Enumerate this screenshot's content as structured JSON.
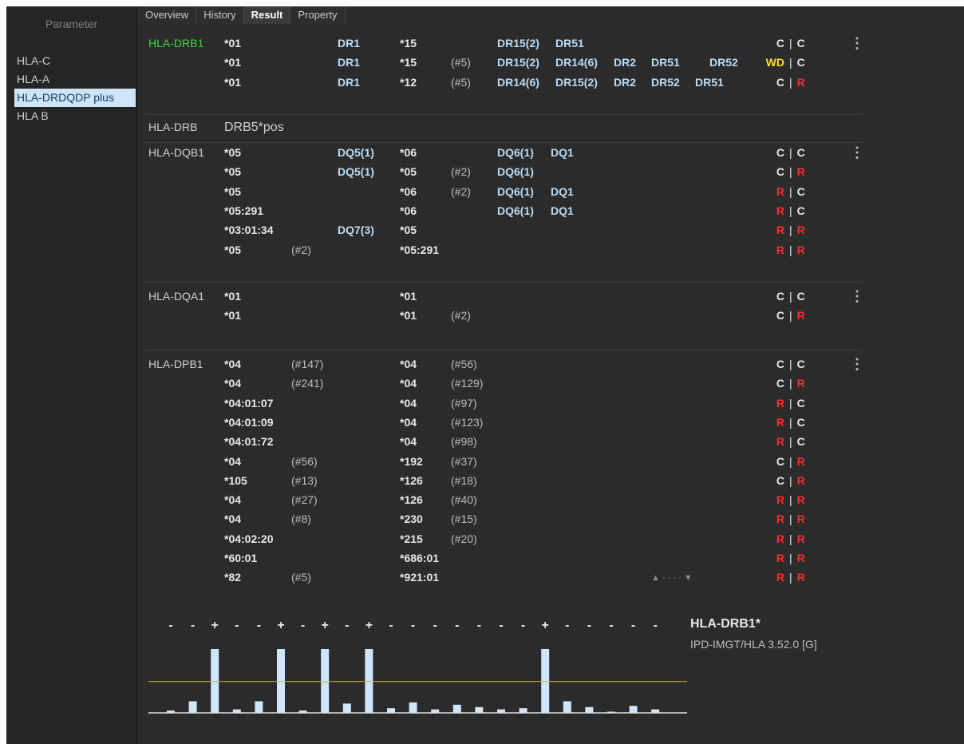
{
  "sidebar": {
    "header": "Parameter",
    "items": [
      {
        "label": "HLA-C",
        "selected": false
      },
      {
        "label": "HLA-A",
        "selected": false
      },
      {
        "label": "HLA-DRDQDP plus",
        "selected": true
      },
      {
        "label": "HLA B",
        "selected": false
      }
    ]
  },
  "tabs": [
    {
      "label": "Overview",
      "active": false
    },
    {
      "label": "History",
      "active": false
    },
    {
      "label": "Result",
      "active": true
    },
    {
      "label": "Property",
      "active": false
    }
  ],
  "colors": {
    "red": "#ff2a2a",
    "green": "#3fd33f",
    "yellow": "#ffde1a",
    "blue": "#b9dcf7"
  },
  "sections": [
    {
      "locus": "HLA-DRB1",
      "locus_color": "green",
      "menu": true,
      "rows": [
        {
          "a1": "*01",
          "n1": "",
          "s1": [
            "DR1"
          ],
          "a2": "*15",
          "n2": "",
          "s2": [
            "DR15(2)",
            "DR51"
          ],
          "f1": "C",
          "f1c": "",
          "f2": "C",
          "f2c": ""
        },
        {
          "a1": "*01",
          "n1": "",
          "s1": [
            "DR1"
          ],
          "a2": "*15",
          "n2": "(#5)",
          "s2": [
            "DR15(2)",
            "DR14(6)",
            "DR2",
            "DR51",
            "DR52"
          ],
          "f1": "WD",
          "f1c": "yellow",
          "f2": "C",
          "f2c": ""
        },
        {
          "a1": "*01",
          "n1": "",
          "s1": [
            "DR1"
          ],
          "a2": "*12",
          "n2": "(#5)",
          "s2": [
            "DR14(6)",
            "DR15(2)",
            "DR2",
            "DR52",
            "DR51"
          ],
          "f1": "C",
          "f1c": "",
          "f2": "R",
          "f2c": "red"
        }
      ]
    },
    {
      "locus": "HLA-DRB",
      "locus_color": "",
      "menu": false,
      "plain": "DRB5*pos",
      "rows": []
    },
    {
      "locus": "HLA-DQB1",
      "locus_color": "",
      "menu": true,
      "rows": [
        {
          "a1": "*05",
          "n1": "",
          "s1": [
            "DQ5(1)"
          ],
          "a2": "*06",
          "n2": "",
          "s2": [
            "DQ6(1)",
            "DQ1"
          ],
          "f1": "C",
          "f1c": "",
          "f2": "C",
          "f2c": ""
        },
        {
          "a1": "*05",
          "n1": "",
          "s1": [
            "DQ5(1)"
          ],
          "a2": "*05",
          "n2": "(#2)",
          "s2": [
            "DQ6(1)"
          ],
          "f1": "C",
          "f1c": "",
          "f2": "R",
          "f2c": "red"
        },
        {
          "a1": "*05",
          "n1": "",
          "s1": [],
          "a2": "*06",
          "n2": "(#2)",
          "s2": [
            "DQ6(1)",
            "DQ1"
          ],
          "f1": "R",
          "f1c": "red",
          "f2": "C",
          "f2c": ""
        },
        {
          "a1": "*05:291",
          "n1": "",
          "s1": [],
          "a2": "*06",
          "n2": "",
          "s2": [
            "DQ6(1)",
            "DQ1"
          ],
          "f1": "R",
          "f1c": "red",
          "f2": "C",
          "f2c": ""
        },
        {
          "a1": "*03:01:34",
          "n1": "",
          "s1": [
            "DQ7(3)"
          ],
          "a2": "*05",
          "n2": "",
          "s2": [],
          "f1": "R",
          "f1c": "red",
          "f2": "R",
          "f2c": "red"
        },
        {
          "a1": "*05",
          "n1": "(#2)",
          "s1": [],
          "a2": "*05:291",
          "n2": "",
          "s2": [],
          "f1": "R",
          "f1c": "red",
          "f2": "R",
          "f2c": "red"
        }
      ]
    },
    {
      "locus": "HLA-DQA1",
      "locus_color": "",
      "menu": true,
      "rows": [
        {
          "a1": "*01",
          "n1": "",
          "s1": [],
          "a2": "*01",
          "n2": "",
          "s2": [],
          "f1": "C",
          "f1c": "",
          "f2": "C",
          "f2c": ""
        },
        {
          "a1": "*01",
          "n1": "",
          "s1": [],
          "a2": "*01",
          "n2": "(#2)",
          "s2": [],
          "f1": "C",
          "f1c": "",
          "f2": "R",
          "f2c": "red"
        }
      ]
    },
    {
      "locus": "HLA-DPB1",
      "locus_color": "",
      "menu": true,
      "rows": [
        {
          "a1": "*04",
          "n1": "(#147)",
          "s1": [],
          "a2": "*04",
          "n2": "(#56)",
          "s2": [],
          "f1": "C",
          "f1c": "",
          "f2": "C",
          "f2c": ""
        },
        {
          "a1": "*04",
          "n1": "(#241)",
          "s1": [],
          "a2": "*04",
          "n2": "(#129)",
          "s2": [],
          "f1": "C",
          "f1c": "",
          "f2": "R",
          "f2c": "red"
        },
        {
          "a1": "*04:01:07",
          "n1": "",
          "s1": [],
          "a2": "*04",
          "n2": "(#97)",
          "s2": [],
          "f1": "R",
          "f1c": "red",
          "f2": "C",
          "f2c": ""
        },
        {
          "a1": "*04:01:09",
          "n1": "",
          "s1": [],
          "a2": "*04",
          "n2": "(#123)",
          "s2": [],
          "f1": "R",
          "f1c": "red",
          "f2": "C",
          "f2c": ""
        },
        {
          "a1": "*04:01:72",
          "n1": "",
          "s1": [],
          "a2": "*04",
          "n2": "(#98)",
          "s2": [],
          "f1": "R",
          "f1c": "red",
          "f2": "C",
          "f2c": ""
        },
        {
          "a1": "*04",
          "n1": "(#56)",
          "s1": [],
          "a2": "*192",
          "n2": "(#37)",
          "s2": [],
          "f1": "C",
          "f1c": "",
          "f2": "R",
          "f2c": "red"
        },
        {
          "a1": "*105",
          "n1": "(#13)",
          "s1": [],
          "a2": "*126",
          "n2": "(#18)",
          "s2": [],
          "f1": "C",
          "f1c": "",
          "f2": "R",
          "f2c": "red"
        },
        {
          "a1": "*04",
          "n1": "(#27)",
          "s1": [],
          "a2": "*126",
          "n2": "(#40)",
          "s2": [],
          "f1": "R",
          "f1c": "red",
          "f2": "R",
          "f2c": "red"
        },
        {
          "a1": "*04",
          "n1": "(#8)",
          "s1": [],
          "a2": "*230",
          "n2": "(#15)",
          "s2": [],
          "f1": "R",
          "f1c": "red",
          "f2": "R",
          "f2c": "red"
        },
        {
          "a1": "*04:02:20",
          "n1": "",
          "s1": [],
          "a2": "*215",
          "n2": "(#20)",
          "s2": [],
          "f1": "R",
          "f1c": "red",
          "f2": "R",
          "f2c": "red"
        },
        {
          "a1": "*60:01",
          "n1": "",
          "s1": [],
          "a2": "*686:01",
          "n2": "",
          "s2": [],
          "f1": "R",
          "f1c": "red",
          "f2": "R",
          "f2c": "red"
        },
        {
          "a1": "*82",
          "n1": "(#5)",
          "s1": [],
          "a2": "*921:01",
          "n2": "",
          "s2": [],
          "f1": "R",
          "f1c": "red",
          "f2": "R",
          "f2c": "red"
        }
      ]
    }
  ],
  "separator": "|",
  "scroll_indicator": "▲ · · · · ▼",
  "signal_panel": {
    "title": "HLA-DRB1*",
    "subtitle": "IPD-IMGT/HLA 3.52.0 [G]"
  },
  "chart_data": {
    "type": "bar",
    "signs": [
      "-",
      "-",
      "+",
      "-",
      "-",
      "+",
      "-",
      "+",
      "-",
      "+",
      "-",
      "-",
      "-",
      "-",
      "-",
      "-",
      "-",
      "+",
      "-",
      "-",
      "-",
      "-",
      "-"
    ],
    "values": [
      2,
      10,
      55,
      3,
      10,
      55,
      2,
      55,
      8,
      55,
      4,
      9,
      3,
      7,
      5,
      3,
      4,
      55,
      10,
      5,
      1,
      6,
      3
    ],
    "threshold": 27,
    "ylim": [
      0,
      60
    ]
  }
}
